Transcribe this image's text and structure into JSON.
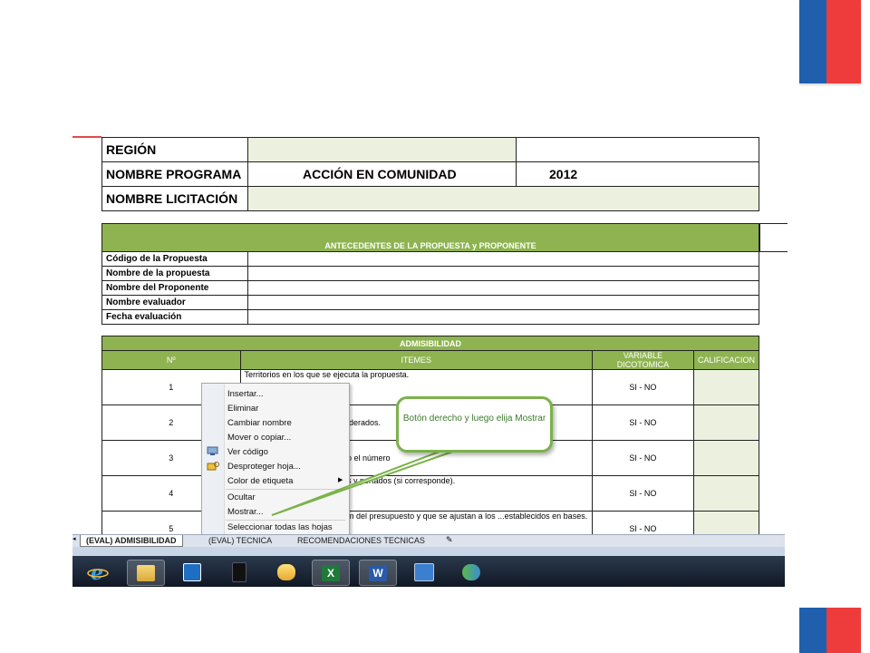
{
  "header": {
    "region_label": "REGIÓN",
    "programa_label": "NOMBRE PROGRAMA",
    "programa_value": "ACCIÓN EN COMUNIDAD",
    "year": "2012",
    "licitacion_label": "NOMBRE LICITACIÓN"
  },
  "antecedentes": {
    "title": "ANTECEDENTES DE LA PROPUESTA y PROPONENTE",
    "rows": [
      "Código de la Propuesta",
      "Nombre de la propuesta",
      "Nombre del Proponente",
      "Nombre evaluador",
      "Fecha evaluación"
    ]
  },
  "admisibilidad": {
    "title": "ADMISIBILIDAD",
    "columns": [
      "Nº",
      "ITEMES",
      "VARIABLE DICOTOMICA",
      "CALIFICACION"
    ],
    "rows": [
      {
        "n": "1",
        "item": "Territorios en los que se ejecuta la propuesta.",
        "value": "SI - NO"
      },
      {
        "n": "2",
        "item": "...iderados.",
        "value": "SI - NO"
      },
      {
        "n": "3",
        "item": "...o el número",
        "value": "SI - NO"
      },
      {
        "n": "4",
        "item": "...s y portados (si corresponde).",
        "value": "SI - NO"
      },
      {
        "n": "5",
        "item": "...m del presupuesto y que se ajustan a los ...establecidos en bases.",
        "value": "SI - NO"
      }
    ]
  },
  "context_menu": {
    "items": [
      "Insertar...",
      "Eliminar",
      "Cambiar nombre",
      "Mover o copiar...",
      "Ver código",
      "Desproteger hoja...",
      "Color de etiqueta",
      "Ocultar",
      "Mostrar...",
      "Seleccionar todas las hojas"
    ]
  },
  "callout": {
    "text": "Botón derecho y luego elija Mostrar"
  },
  "sheet_tabs": [
    "(EVAL) ADMISIBILIDAD",
    "(EVAL) TECNICA",
    "RECOMENDACIONES TECNICAS"
  ],
  "taskbar_icons": [
    "internet-explorer-icon",
    "file-explorer-icon",
    "media-player-icon",
    "app-icon",
    "outlook-icon",
    "excel-icon",
    "word-icon",
    "book-icon",
    "people-icon"
  ],
  "colors": {
    "accent_green": "#8eb350",
    "light_green": "#ebf1de",
    "flag_blue": "#1f5fad",
    "flag_red": "#ee3b3b"
  }
}
